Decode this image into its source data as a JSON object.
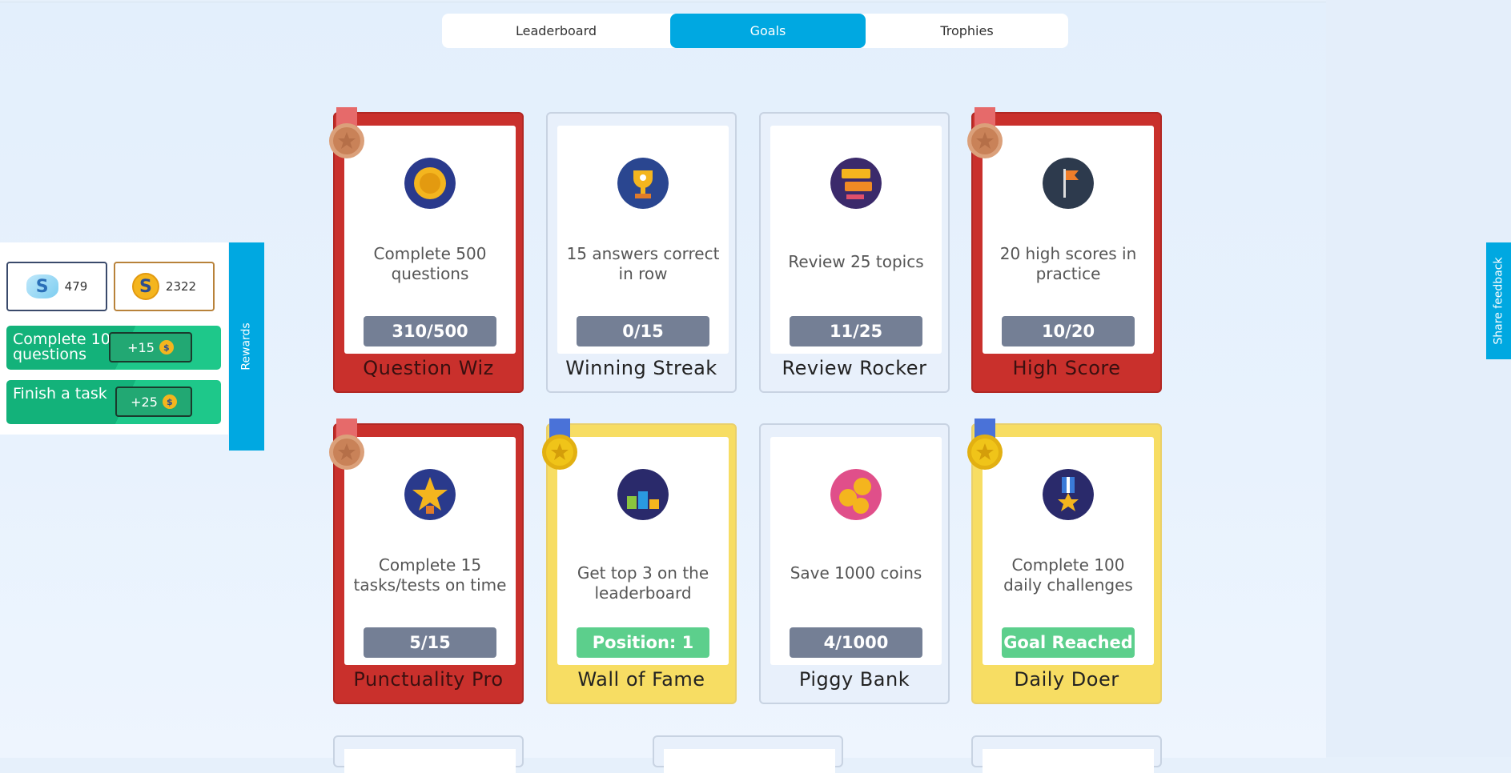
{
  "tabs": [
    {
      "label": "Leaderboard"
    },
    {
      "label": "Goals"
    },
    {
      "label": "Trophies"
    }
  ],
  "sidebar": {
    "gems": "479",
    "coins": "2322",
    "gem_symbol": "S",
    "coin_symbol": "S",
    "tasks": [
      {
        "label": "Complete 10 questions",
        "reward": "+15"
      },
      {
        "label": "Finish a task",
        "reward": "+25"
      }
    ],
    "rewards_tab": "Rewards"
  },
  "feedback": "Share feedback",
  "cards": [
    {
      "desc": "Complete 500 questions",
      "progress": "310/500",
      "title": "Question Wiz",
      "style": "red",
      "medal": "bronze"
    },
    {
      "desc": "15 answers correct in row",
      "progress": "0/15",
      "title": "Winning Streak",
      "style": "plain",
      "medal": "none"
    },
    {
      "desc": "Review 25 topics",
      "progress": "11/25",
      "title": "Review Rocker",
      "style": "plain",
      "medal": "none"
    },
    {
      "desc": "20 high scores in practice",
      "progress": "10/20",
      "title": "High Score",
      "style": "red",
      "medal": "bronze"
    },
    {
      "desc": "Complete 15 tasks/tests on time",
      "progress": "5/15",
      "title": "Punctuality Pro",
      "style": "red",
      "medal": "bronze"
    },
    {
      "desc": "Get top 3 on the leaderboard",
      "progress": "Position: 1",
      "title": "Wall of Fame",
      "style": "gold",
      "medal": "gold"
    },
    {
      "desc": "Save 1000 coins",
      "progress": "4/1000",
      "title": "Piggy Bank",
      "style": "plain",
      "medal": "none"
    },
    {
      "desc": "Complete 100 daily challenges",
      "progress": "Goal Reached",
      "title": "Daily Doer",
      "style": "gold",
      "medal": "gold"
    }
  ],
  "colors": {
    "accent": "#00a8e1",
    "card_red": "#c9302c",
    "card_gold": "#f7dd63",
    "progress_grey": "#747f95",
    "progress_green": "#5ccf8c",
    "task_green": "#13b27a"
  }
}
